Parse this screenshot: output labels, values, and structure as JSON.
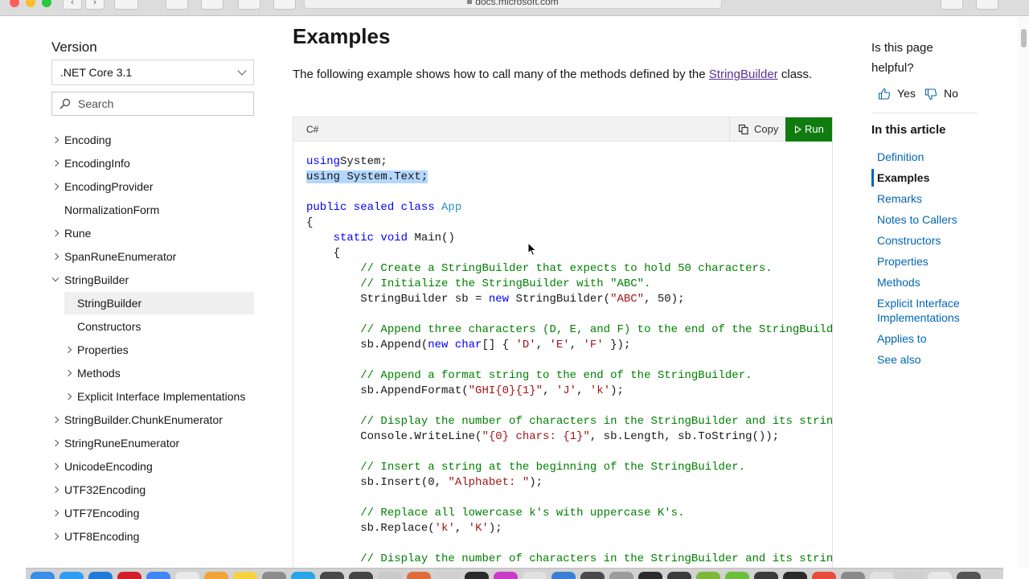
{
  "browser": {
    "url": "docs.microsoft.com"
  },
  "sidebar": {
    "version_label": "Version",
    "version_value": ".NET Core 3.1",
    "search_placeholder": "Search",
    "items": [
      {
        "label": "Encoding",
        "indent": 0,
        "arrow": "right"
      },
      {
        "label": "EncodingInfo",
        "indent": 0,
        "arrow": "right"
      },
      {
        "label": "EncodingProvider",
        "indent": 0,
        "arrow": "right"
      },
      {
        "label": "NormalizationForm",
        "indent": 0,
        "arrow": "none"
      },
      {
        "label": "Rune",
        "indent": 0,
        "arrow": "right"
      },
      {
        "label": "SpanRuneEnumerator",
        "indent": 0,
        "arrow": "right"
      },
      {
        "label": "StringBuilder",
        "indent": 0,
        "arrow": "down"
      },
      {
        "label": "StringBuilder",
        "indent": 1,
        "arrow": "none",
        "selected": true
      },
      {
        "label": "Constructors",
        "indent": 1,
        "arrow": "none"
      },
      {
        "label": "Properties",
        "indent": 1,
        "arrow": "right"
      },
      {
        "label": "Methods",
        "indent": 1,
        "arrow": "right"
      },
      {
        "label": "Explicit Interface Implementations",
        "indent": 1,
        "arrow": "right"
      },
      {
        "label": "StringBuilder.ChunkEnumerator",
        "indent": 0,
        "arrow": "right"
      },
      {
        "label": "StringRuneEnumerator",
        "indent": 0,
        "arrow": "right"
      },
      {
        "label": "UnicodeEncoding",
        "indent": 0,
        "arrow": "right"
      },
      {
        "label": "UTF32Encoding",
        "indent": 0,
        "arrow": "right"
      },
      {
        "label": "UTF7Encoding",
        "indent": 0,
        "arrow": "right"
      },
      {
        "label": "UTF8Encoding",
        "indent": 0,
        "arrow": "right"
      }
    ]
  },
  "main": {
    "heading": "Examples",
    "intro_before": "The following example shows how to call many of the methods defined by the ",
    "intro_link": "StringBuilder",
    "intro_after": " class.",
    "code": {
      "language": "C#",
      "copy_label": "Copy",
      "run_label": "Run",
      "lines": [
        [
          [
            "kw",
            "using"
          ],
          [
            "",
            "System;"
          ]
        ],
        [
          [
            "hl",
            "using System.Text;"
          ]
        ],
        [],
        [
          [
            "kw",
            "public sealed class "
          ],
          [
            "ty",
            "App"
          ]
        ],
        [
          [
            "",
            "{"
          ]
        ],
        [
          [
            "",
            "    "
          ],
          [
            "kw",
            "static void "
          ],
          [
            "",
            "Main()"
          ]
        ],
        [
          [
            "",
            "    {"
          ]
        ],
        [
          [
            "",
            "        "
          ],
          [
            "cm",
            "// Create a StringBuilder that expects to hold 50 characters."
          ]
        ],
        [
          [
            "",
            "        "
          ],
          [
            "cm",
            "// Initialize the StringBuilder with \"ABC\"."
          ]
        ],
        [
          [
            "",
            "        StringBuilder sb = "
          ],
          [
            "kw",
            "new "
          ],
          [
            "",
            "StringBuilder("
          ],
          [
            "st",
            "\"ABC\""
          ],
          [
            "",
            ", 50);"
          ]
        ],
        [],
        [
          [
            "",
            "        "
          ],
          [
            "cm",
            "// Append three characters (D, E, and F) to the end of the StringBuilder."
          ]
        ],
        [
          [
            "",
            "        sb.Append("
          ],
          [
            "kw",
            "new char"
          ],
          [
            "",
            "[] { "
          ],
          [
            "st",
            "'D'"
          ],
          [
            "",
            ", "
          ],
          [
            "st",
            "'E'"
          ],
          [
            "",
            ", "
          ],
          [
            "st",
            "'F'"
          ],
          [
            "",
            " });"
          ]
        ],
        [],
        [
          [
            "",
            "        "
          ],
          [
            "cm",
            "// Append a format string to the end of the StringBuilder."
          ]
        ],
        [
          [
            "",
            "        sb.AppendFormat("
          ],
          [
            "st",
            "\"GHI{0}{1}\""
          ],
          [
            "",
            ", "
          ],
          [
            "st",
            "'J'"
          ],
          [
            "",
            ", "
          ],
          [
            "st",
            "'k'"
          ],
          [
            "",
            ");"
          ]
        ],
        [],
        [
          [
            "",
            "        "
          ],
          [
            "cm",
            "// Display the number of characters in the StringBuilder and its string."
          ]
        ],
        [
          [
            "",
            "        Console.WriteLine("
          ],
          [
            "st",
            "\"{0} chars: {1}\""
          ],
          [
            "",
            ", sb.Length, sb.ToString());"
          ]
        ],
        [],
        [
          [
            "",
            "        "
          ],
          [
            "cm",
            "// Insert a string at the beginning of the StringBuilder."
          ]
        ],
        [
          [
            "",
            "        sb.Insert(0, "
          ],
          [
            "st",
            "\"Alphabet: \""
          ],
          [
            "",
            ");"
          ]
        ],
        [],
        [
          [
            "",
            "        "
          ],
          [
            "cm",
            "// Replace all lowercase k's with uppercase K's."
          ]
        ],
        [
          [
            "",
            "        sb.Replace("
          ],
          [
            "st",
            "'k'"
          ],
          [
            "",
            ", "
          ],
          [
            "st",
            "'K'"
          ],
          [
            "",
            ");"
          ]
        ],
        [],
        [
          [
            "",
            "        "
          ],
          [
            "cm",
            "// Display the number of characters in the StringBuilder and its string."
          ]
        ]
      ]
    }
  },
  "right": {
    "helpful_question": "Is this page helpful?",
    "yes_label": "Yes",
    "no_label": "No",
    "toc_title": "In this article",
    "toc": [
      {
        "label": "Definition"
      },
      {
        "label": "Examples",
        "active": true
      },
      {
        "label": "Remarks"
      },
      {
        "label": "Notes to Callers"
      },
      {
        "label": "Constructors"
      },
      {
        "label": "Properties"
      },
      {
        "label": "Methods"
      },
      {
        "label": "Explicit Interface Implementations"
      },
      {
        "label": "Applies to"
      },
      {
        "label": "See also"
      }
    ]
  },
  "colors": {
    "link": "#0065b3",
    "visited_link": "#5c2d91",
    "run_button": "#107c10",
    "keyword": "#0000ff",
    "type": "#2b91af",
    "comment": "#008000",
    "string": "#a31515",
    "selection": "#b3d7ff"
  },
  "dock": {
    "icon_colors": [
      "#3a8ee6",
      "#2f9df4",
      "#1f7ad8",
      "#d21f2a",
      "#4286f4",
      "#e9e9e9",
      "#f2a33c",
      "#f7d23e",
      "#8c8c8c",
      "#29a5e8",
      "#4a4a4a",
      "#444444",
      "#c9c9c9",
      "#e06c3c",
      "#d0d0d0",
      "#2a2a2a",
      "#c83cc8",
      "#e0e0e0",
      "#3c7fd6",
      "#4a4a4a",
      "#9c9c9c",
      "#2b2b2b",
      "#3b3b3b",
      "#7db83c",
      "#6cbf3c",
      "#3b3b3b",
      "#2a2a2a",
      "#e84c3c",
      "#8a8a8a",
      "#e0e0e0",
      "#cfcfcf",
      "#e8e8e8",
      "#555555"
    ]
  }
}
